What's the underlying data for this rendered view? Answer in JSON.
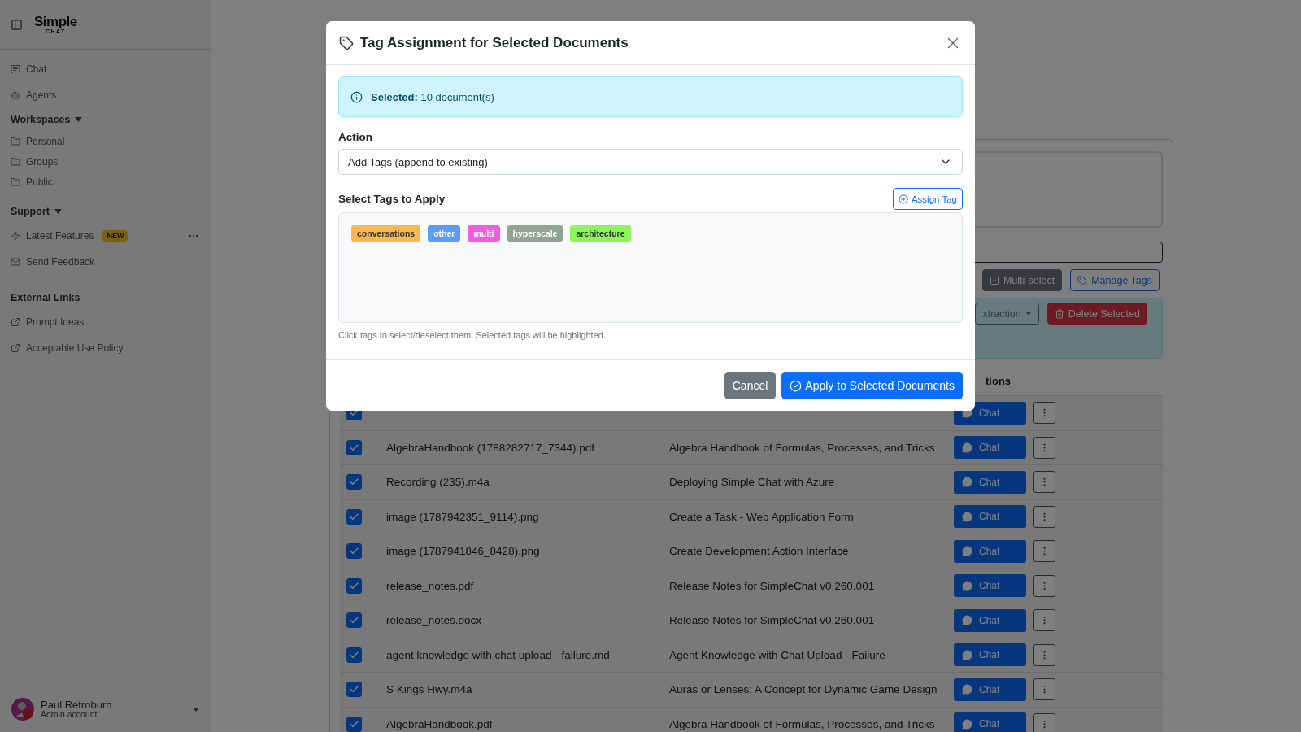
{
  "sidebar": {
    "logo": {
      "name": "Simple",
      "sub": "CHAT"
    },
    "nav": [
      {
        "label": "Chat"
      },
      {
        "label": "Agents"
      }
    ],
    "groups": [
      {
        "title": "Workspaces",
        "expanded": true,
        "items": [
          {
            "label": "Personal"
          },
          {
            "label": "Groups"
          },
          {
            "label": "Public"
          }
        ]
      },
      {
        "title": "Support",
        "expanded": true,
        "items": [
          {
            "label": "Latest Features",
            "badge": "NEW"
          },
          {
            "label": "Send Feedback"
          }
        ]
      },
      {
        "title": "External Links",
        "items": [
          {
            "label": "Prompt Ideas"
          },
          {
            "label": "Acceptable Use Policy"
          }
        ]
      }
    ],
    "user": {
      "name": "Paul Retroburn",
      "role": "Admin account"
    }
  },
  "toolbar": {
    "buttons": [
      {
        "label": "Multi-select",
        "kind": "dark"
      },
      {
        "label": "Manage Tags",
        "kind": "outline"
      }
    ]
  },
  "bulk_bar": {
    "buttons": [
      {
        "label": "xtraction",
        "kind": "dropdown"
      },
      {
        "label": "Delete Selected",
        "kind": "danger"
      }
    ]
  },
  "table": {
    "header": "tions",
    "rows": [
      {
        "checked": true,
        "action": "Chat"
      },
      {
        "checked": true,
        "file": "AlgebraHandbook (1788282717_7344).pdf",
        "title": "Algebra Handbook of Formulas, Processes, and Tricks",
        "action": "Chat"
      },
      {
        "checked": true,
        "file": "Recording (235).m4a",
        "title": "Deploying Simple Chat with Azure",
        "action": "Chat"
      },
      {
        "checked": true,
        "file": "image (1787942351_9114).png",
        "title": "Create a Task - Web Application Form",
        "action": "Chat"
      },
      {
        "checked": true,
        "file": "image (1787941846_8428).png",
        "title": "Create Development Action Interface",
        "action": "Chat"
      },
      {
        "checked": true,
        "file": "release_notes.pdf",
        "title": "Release Notes for SimpleChat v0.260.001",
        "action": "Chat"
      },
      {
        "checked": true,
        "file": "release_notes.docx",
        "title": "Release Notes for SimpleChat v0.260.001",
        "action": "Chat"
      },
      {
        "checked": true,
        "file": "agent knowledge with chat upload - failure.md",
        "title": "Agent Knowledge with Chat Upload - Failure",
        "action": "Chat"
      },
      {
        "checked": true,
        "file": "S Kings Hwy.m4a",
        "title": "Auras or Lenses: A Concept for Dynamic Game Design",
        "action": "Chat"
      },
      {
        "checked": true,
        "file": "AlgebraHandbook.pdf",
        "title": "Algebra Handbook of Formulas, Processes, and Tricks",
        "action": "Chat"
      }
    ]
  },
  "modal": {
    "title": "Tag Assignment for Selected Documents",
    "alert": "**Selected:** 10 document(s)",
    "action_label": "Action",
    "action_value": "Add Tags (append to existing)",
    "tags_label": "Select Tags to Apply",
    "assign_button": "Assign Tag",
    "tags": [
      {
        "label": "conversations",
        "color": "#f8b84e",
        "selected": false
      },
      {
        "label": "other",
        "color": "#5b9cf8",
        "selected": false
      },
      {
        "label": "multi",
        "color": "#f65ce0",
        "selected": false
      },
      {
        "label": "hyperscale",
        "color": "#8fa58f",
        "selected": false
      },
      {
        "label": "architecture",
        "color": "#8cf55a",
        "selected": false
      }
    ],
    "help": "Click tags to select/deselect them. Selected tags will be highlighted.",
    "buttons": [
      {
        "label": "Cancel",
        "kind": "secondary"
      },
      {
        "label": "Apply to Selected Documents",
        "kind": "primary"
      }
    ]
  }
}
